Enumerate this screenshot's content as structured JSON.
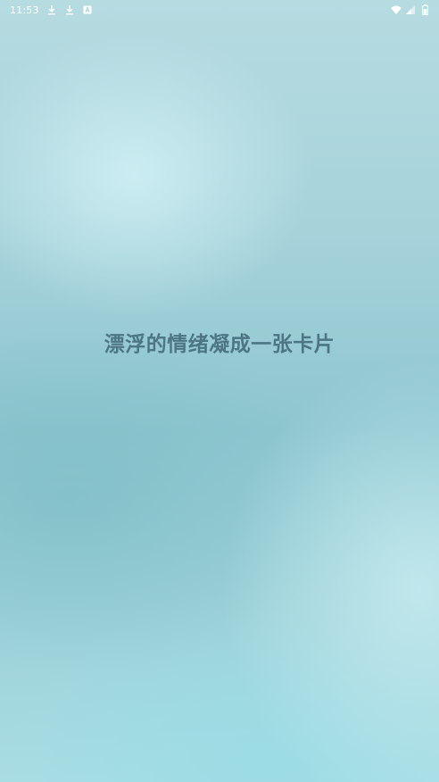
{
  "status_bar": {
    "time": "11:53",
    "icons_left": [
      "download-icon",
      "download-icon",
      "app-notification-icon"
    ],
    "icons_right": [
      "wifi-icon",
      "signal-icon",
      "battery-icon"
    ]
  },
  "main": {
    "slogan": "漂浮的情绪凝成一张卡片"
  },
  "colors": {
    "text": "#4d7582",
    "status_text": "#ffffff",
    "background_top": "#b6dbe1",
    "background_mid": "#8ec6cf",
    "background_bottom": "#a9dde3"
  }
}
